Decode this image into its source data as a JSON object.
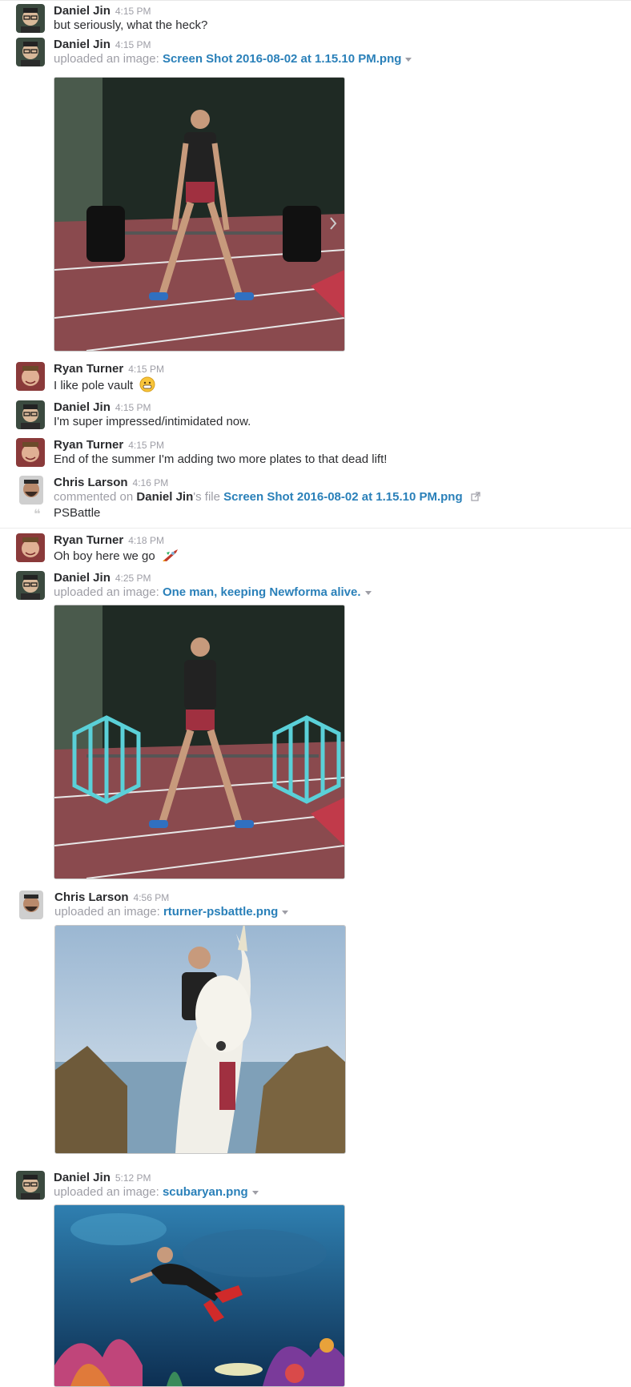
{
  "messages": [
    {
      "author": "Daniel Jin",
      "time": "4:15 PM",
      "text": "but seriously, what the heck?"
    },
    {
      "author": "Daniel Jin",
      "time": "4:15 PM",
      "prefix": "uploaded an image:",
      "file": "Screen Shot 2016-08-02 at 1.15.10 PM.png"
    },
    {
      "author": "Ryan Turner",
      "time": "4:15 PM",
      "text": "I like pole vault"
    },
    {
      "author": "Daniel Jin",
      "time": "4:15 PM",
      "text": "I'm super impressed/intimidated now."
    },
    {
      "author": "Ryan Turner",
      "time": "4:15 PM",
      "text": "End of the summer I'm adding two more plates to that dead lift!"
    },
    {
      "author": "Chris Larson",
      "time": "4:16 PM",
      "prefix": "commented on",
      "target_user": "Daniel Jin",
      "possessive": "'s file",
      "file": "Screen Shot 2016-08-02 at 1.15.10 PM.png",
      "comment": "PSBattle"
    },
    {
      "author": "Ryan Turner",
      "time": "4:18 PM",
      "text": "Oh boy here we go"
    },
    {
      "author": "Daniel Jin",
      "time": "4:25 PM",
      "prefix": "uploaded an image:",
      "file": "One man, keeping Newforma alive."
    },
    {
      "author": "Chris Larson",
      "time": "4:56 PM",
      "prefix": "uploaded an image:",
      "file": "rturner-psbattle.png"
    },
    {
      "author": "Daniel Jin",
      "time": "5:12 PM",
      "prefix": "uploaded an image:",
      "file": "scubaryan.png"
    }
  ],
  "icons": {
    "emoji_grin": "grinning-face-icon",
    "emoji_rocket": "rocket-icon",
    "external_link": "external-link-icon",
    "quote": "quote-icon",
    "file_menu": "chevron-down-icon"
  },
  "colors": {
    "link": "#2a80b9",
    "muted": "#9e9ea6",
    "text": "#2c2d30"
  }
}
